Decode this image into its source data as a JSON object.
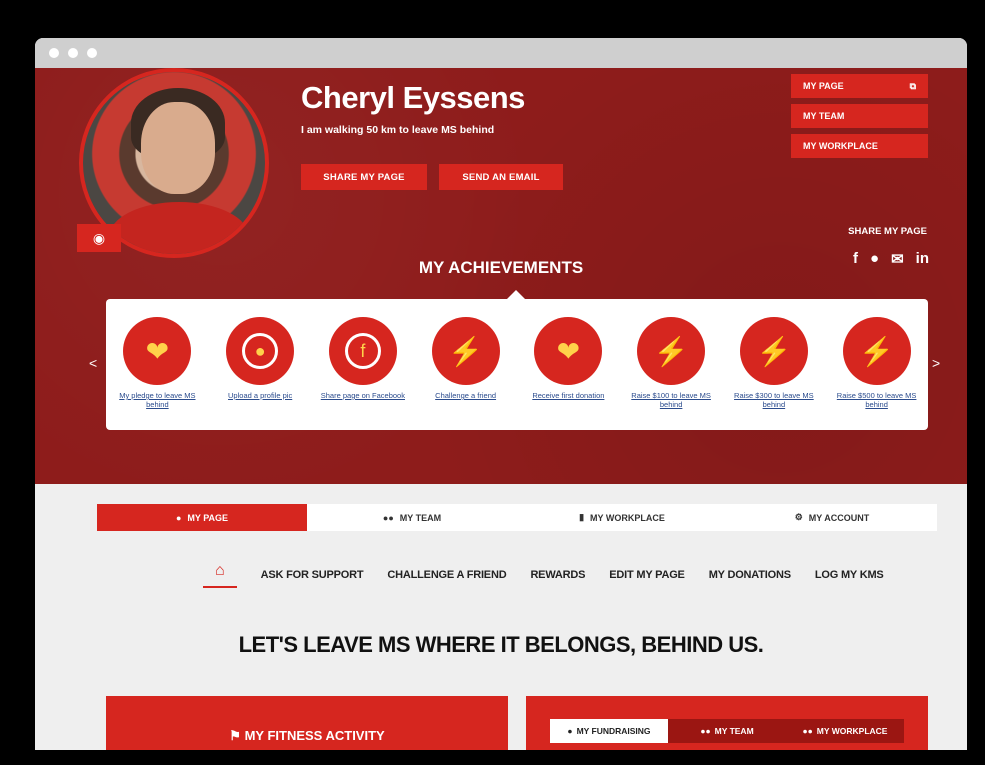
{
  "profile": {
    "name": "Cheryl Eyssens",
    "tagline": "I am walking 50 km to leave MS behind",
    "share_page_button": "SHARE MY PAGE",
    "send_email_button": "SEND AN EMAIL"
  },
  "side_nav": {
    "my_page": "MY PAGE",
    "my_team": "MY TEAM",
    "my_workplace": "MY WORKPLACE"
  },
  "share": {
    "label": "SHARE MY PAGE",
    "icons": [
      "facebook-icon",
      "twitter-icon",
      "email-icon",
      "linkedin-icon"
    ]
  },
  "achievements": {
    "title": "MY ACHIEVEMENTS",
    "items": [
      {
        "label": "My pledge to leave MS behind",
        "icon": "heart-person-icon"
      },
      {
        "label": "Upload a profile pic",
        "icon": "profile-upload-icon"
      },
      {
        "label": "Share page on Facebook",
        "icon": "facebook-share-icon"
      },
      {
        "label": "Challenge a friend",
        "icon": "challenge-icon"
      },
      {
        "label": "Receive first donation",
        "icon": "donation-hand-icon"
      },
      {
        "label": "Raise $100 to leave MS behind",
        "icon": "raise-100-icon"
      },
      {
        "label": "Raise $300 to leave MS behind",
        "icon": "raise-300-icon"
      },
      {
        "label": "Raise $500 to leave MS behind",
        "icon": "raise-500-icon"
      }
    ]
  },
  "main_tabs": {
    "my_page": "MY PAGE",
    "my_team": "MY TEAM",
    "my_workplace": "MY WORKPLACE",
    "my_account": "MY ACCOUNT"
  },
  "subnav": {
    "ask": "ASK FOR SUPPORT",
    "challenge": "CHALLENGE A FRIEND",
    "rewards": "REWARDS",
    "edit": "EDIT MY PAGE",
    "donations": "MY DONATIONS",
    "log": "LOG MY KMS"
  },
  "headline": "LET'S LEAVE MS WHERE IT BELONGS, BEHIND US.",
  "fitness_panel": {
    "title": "MY FITNESS ACTIVITY"
  },
  "fundraising_panel": {
    "tabs": {
      "fundraising": "MY FUNDRAISING",
      "team": "MY TEAM",
      "workplace": "MY WORKPLACE"
    }
  },
  "colors": {
    "brand_red": "#d6261f",
    "hero_dark_red": "#8e1c1b",
    "badge_yellow": "#ffd24a"
  }
}
